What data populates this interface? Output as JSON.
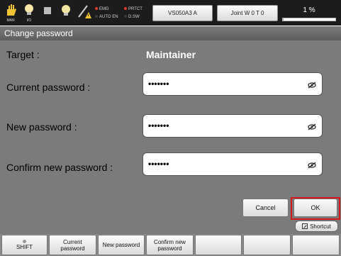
{
  "status_bar": {
    "icons": [
      {
        "name": "man-icon",
        "label": "MAN"
      },
      {
        "name": "io-icon",
        "label": "I/O"
      },
      {
        "name": "stop-icon",
        "label": ""
      },
      {
        "name": "lamp-icon",
        "label": ""
      },
      {
        "name": "tool-warning-icon",
        "label": ""
      }
    ],
    "indicators": [
      {
        "label": "EMG",
        "color": "#e03a2a"
      },
      {
        "label": "PRTCT",
        "color": "#e03a2a"
      },
      {
        "label": "AUTO EN",
        "color": "#3a3a3a"
      },
      {
        "label": "D.SW",
        "color": "#3a3a3a"
      }
    ],
    "robot_button": "VS050A3 A",
    "joint_button": "Joint W 0 T 0",
    "speed_percent_text": "1 %",
    "speed_percent_value": 1
  },
  "title": "Change password",
  "form": {
    "target_label": "Target :",
    "target_value": "Maintainer",
    "current_label": "Current password :",
    "current_value": "•••••••",
    "new_label": "New password :",
    "new_value": "•••••••",
    "confirm_label": "Confirm new password :",
    "confirm_value": "•••••••"
  },
  "actions": {
    "cancel": "Cancel",
    "ok": "OK"
  },
  "shortcut_label": "Shortcut",
  "function_keys": [
    {
      "line1": "",
      "line2": "SHIFT"
    },
    {
      "line1": "Current",
      "line2": "password"
    },
    {
      "line1": "New password",
      "line2": ""
    },
    {
      "line1": "Confirm new",
      "line2": "password"
    },
    {
      "line1": "",
      "line2": ""
    },
    {
      "line1": "",
      "line2": ""
    },
    {
      "line1": "",
      "line2": ""
    }
  ],
  "colors": {
    "panel_gray": "#7b7b7b",
    "topbar": "#1c1c1c",
    "highlight_red": "#d21a1a"
  }
}
